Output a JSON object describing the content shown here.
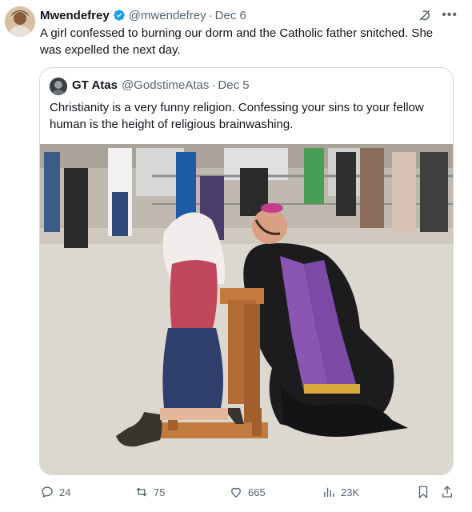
{
  "tweet": {
    "name": "Mwendefrey",
    "handle": "@mwendefrey",
    "sep": "·",
    "date": "Dec 6",
    "text": "A girl confessed to burning our dorm and the Catholic father snitched. She was expelled the next day.",
    "more_icon": "more-icon"
  },
  "quoted": {
    "name": "GT Atas",
    "handle": "@GodstimeAtas",
    "sep": "·",
    "date": "Dec 5",
    "text": "Christianity is a very funny religion. Confessing your sins to your fellow human is the height of religious brainwashing."
  },
  "actions": {
    "replies": "24",
    "reposts": "75",
    "likes": "665",
    "views": "23K"
  },
  "colors": {
    "verified": "#1d9bf0",
    "muted": "#536471",
    "border": "#cfd9de"
  }
}
